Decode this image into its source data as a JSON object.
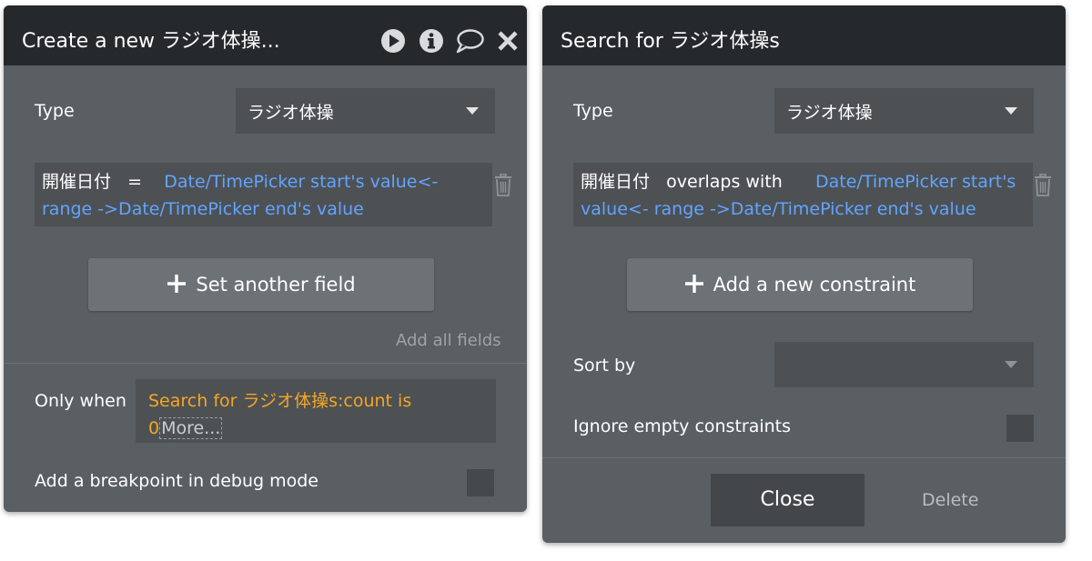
{
  "left_panel": {
    "title": "Create a new ラジオ体操...",
    "type_label": "Type",
    "type_value": "ラジオ体操",
    "constraint": {
      "field": "開催日付",
      "operator": "=",
      "value": "Date/TimePicker start's value<- range ->Date/TimePicker end's value"
    },
    "set_field_button": "Set another field",
    "add_all_fields": "Add all fields",
    "only_when_label": "Only when",
    "only_when_value": "Search for ラジオ体操s:count is 0",
    "more_label": "More...",
    "breakpoint_label": "Add a breakpoint in debug mode"
  },
  "right_panel": {
    "title": "Search for ラジオ体操s",
    "type_label": "Type",
    "type_value": "ラジオ体操",
    "constraint": {
      "field": "開催日付",
      "operator": "overlaps with",
      "value": "Date/TimePicker start's value<- range ->Date/TimePicker end's value"
    },
    "add_constraint_button": "Add a new constraint",
    "sort_by_label": "Sort by",
    "sort_by_value": "",
    "ignore_empty_label": "Ignore empty constraints",
    "close_button": "Close",
    "delete_button": "Delete"
  },
  "colors": {
    "panel_bg": "#5a5f63",
    "header_bg": "#25292b",
    "input_bg": "#4d5154",
    "link_blue": "#62a4ff",
    "condition_orange": "#f5a623"
  },
  "icons": [
    "play-icon",
    "info-icon",
    "comment-icon",
    "close-icon",
    "trash-icon",
    "plus-icon",
    "caret-down-icon"
  ]
}
